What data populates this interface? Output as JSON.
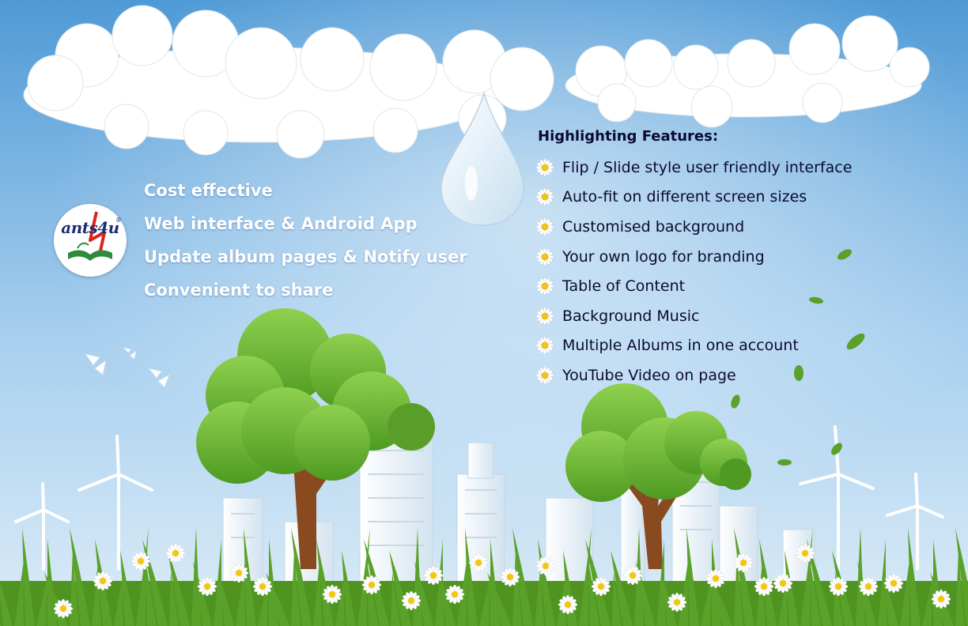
{
  "brand": {
    "logo_text": "ants4u",
    "registered_mark": "®",
    "logo_color": "#1d2f73",
    "accent_color": "#d9241c"
  },
  "left_list": [
    "Cost effective",
    "Web interface & Android App",
    "Update album pages & Notify user",
    "Convenient to share"
  ],
  "features": {
    "title": "Highlighting Features:",
    "items": [
      "Flip / Slide style user friendly interface",
      "Auto-fit on different screen sizes",
      "Customised background",
      "Your own logo for branding",
      "Table of Content",
      "Background Music",
      "Multiple Albums in one account",
      "YouTube Video on page"
    ],
    "bullet_icon": "daisy-icon"
  },
  "colors": {
    "sky_top": "#4f9ad6",
    "sky_mid": "#c9e3f4",
    "grass": "#5aa12a",
    "tree": "#7cc142",
    "text_dark": "#0b0b2e"
  }
}
